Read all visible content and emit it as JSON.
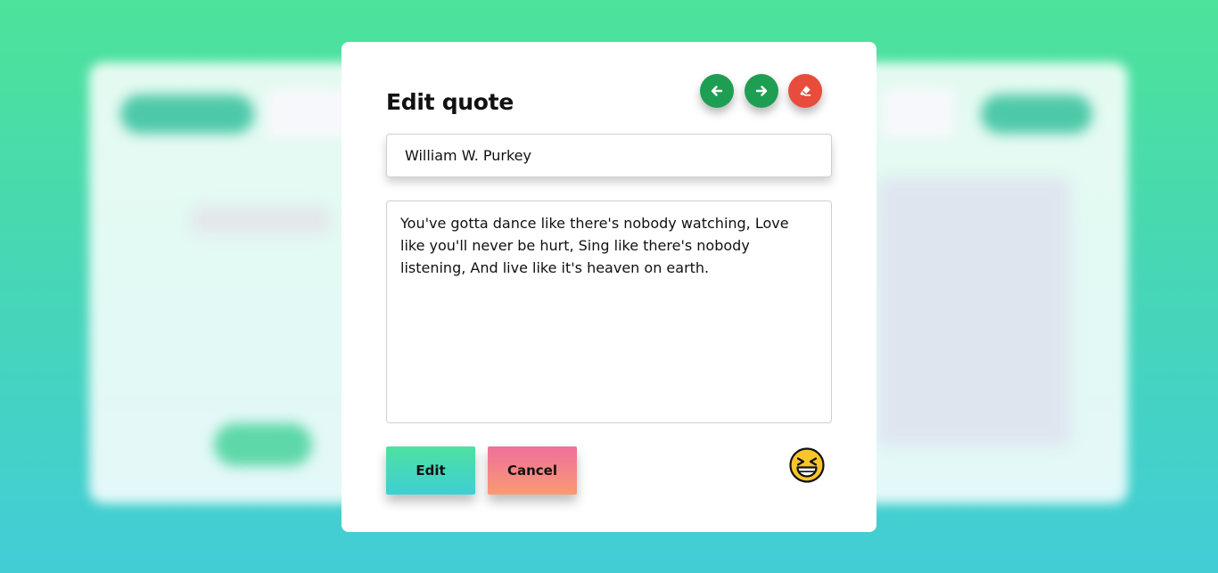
{
  "modal": {
    "title": "Edit quote",
    "author_value": "William W. Purkey",
    "quote_value": "You've gotta dance like there's nobody watching, Love like you'll never be hurt, Sing like there's nobody listening, And live like it's heaven on earth.",
    "edit_label": "Edit",
    "cancel_label": "Cancel"
  },
  "icons": {
    "prev": "arrow-left-icon",
    "next": "arrow-right-icon",
    "clear": "eraser-icon",
    "mood": "laughing-emoji-icon"
  },
  "colors": {
    "green_button": "#1e9e52",
    "red_button": "#e74c3c",
    "edit_gradient_top": "#4fe0a0",
    "edit_gradient_bottom": "#3ecfd4",
    "cancel_gradient_top": "#ef6f9c",
    "cancel_gradient_bottom": "#f99a72"
  }
}
